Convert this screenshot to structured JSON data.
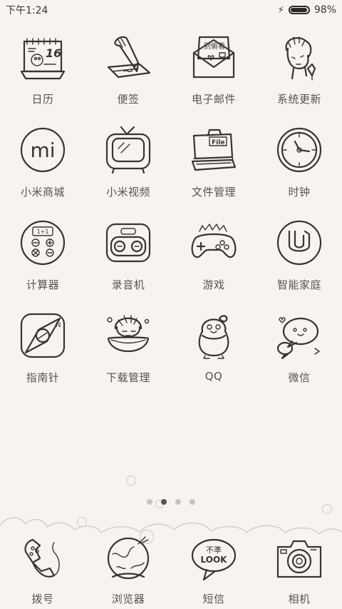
{
  "status_bar": {
    "time": "下午1:24",
    "battery_percent": "98%",
    "battery_level": 0.98,
    "icons": [
      "charging-bolt-icon",
      "battery-icon"
    ]
  },
  "apps": [
    {
      "label": "日历",
      "icon": "calendar-icon"
    },
    {
      "label": "便签",
      "icon": "notes-icon"
    },
    {
      "label": "电子邮件",
      "icon": "email-icon"
    },
    {
      "label": "系统更新",
      "icon": "system-update-icon"
    },
    {
      "label": "小米商城",
      "icon": "mi-store-icon"
    },
    {
      "label": "小米视频",
      "icon": "mi-video-icon"
    },
    {
      "label": "文件管理",
      "icon": "file-manager-icon"
    },
    {
      "label": "时钟",
      "icon": "clock-icon"
    },
    {
      "label": "计算器",
      "icon": "calculator-icon"
    },
    {
      "label": "录音机",
      "icon": "recorder-icon"
    },
    {
      "label": "游戏",
      "icon": "game-controller-icon"
    },
    {
      "label": "智能家庭",
      "icon": "smart-home-icon"
    },
    {
      "label": "指南针",
      "icon": "compass-icon"
    },
    {
      "label": "下载管理",
      "icon": "download-manager-icon"
    },
    {
      "label": "QQ",
      "icon": "qq-penguin-icon"
    },
    {
      "label": "微信",
      "icon": "wechat-icon"
    }
  ],
  "icon_text": {
    "calendar_day": "16",
    "email_stamp": "别偷看",
    "file_tag": "File",
    "calc_display": "1+1",
    "mi_logo": "mi",
    "compass_n": "N",
    "look_top": "不準",
    "look_bottom": "LOOK"
  },
  "page_indicator": {
    "count": 4,
    "active_index": 1
  },
  "dock": [
    {
      "label": "拨号",
      "icon": "phone-dialer-icon"
    },
    {
      "label": "浏览器",
      "icon": "browser-globe-icon"
    },
    {
      "label": "短信",
      "icon": "messages-icon"
    },
    {
      "label": "相机",
      "icon": "camera-icon"
    }
  ]
}
